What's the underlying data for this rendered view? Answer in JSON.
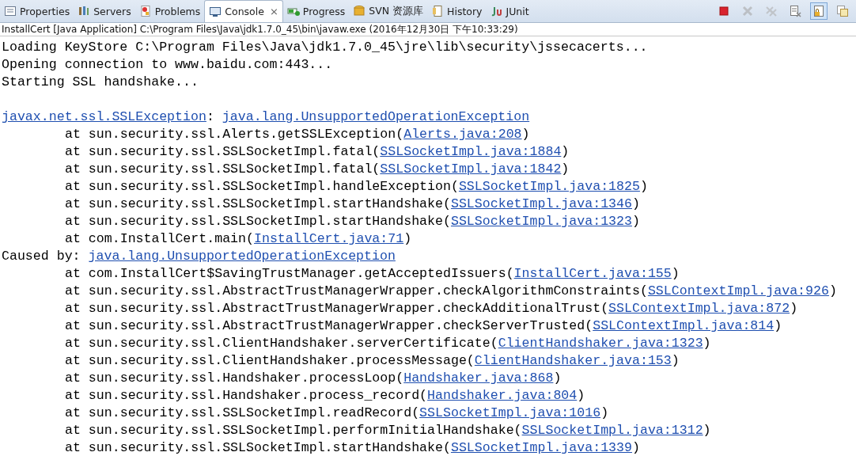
{
  "tabs": [
    {
      "label": "Properties",
      "selected": false
    },
    {
      "label": "Servers",
      "selected": false
    },
    {
      "label": "Problems",
      "selected": false
    },
    {
      "label": "Console",
      "selected": true,
      "close": "⨯"
    },
    {
      "label": "Progress",
      "selected": false
    },
    {
      "label": "SVN 资源库",
      "selected": false
    },
    {
      "label": "History",
      "selected": false
    },
    {
      "label": "JUnit",
      "selected": false
    }
  ],
  "toolbar": [
    {
      "kind": "stop",
      "disabled": false,
      "selected": false
    },
    {
      "kind": "remove",
      "disabled": true,
      "selected": false
    },
    {
      "kind": "remove-all",
      "disabled": true,
      "selected": false
    },
    {
      "kind": "clear",
      "disabled": false,
      "selected": false
    },
    {
      "kind": "scroll-lock",
      "disabled": false,
      "selected": true
    },
    {
      "kind": "word-wrap",
      "disabled": false,
      "selected": false
    }
  ],
  "status_line": "InstallCert [Java Application] C:\\Program Files\\Java\\jdk1.7.0_45\\bin\\javaw.exe (2016年12月30日 下午10:33:29)",
  "console_lines": [
    {
      "kind": "message",
      "parts": [
        {
          "kind": "text",
          "text": "Loading KeyStore C:\\Program Files\\Java\\jdk1.7.0_45\\jre\\lib\\security\\jssecacerts..."
        }
      ]
    },
    {
      "kind": "message",
      "parts": [
        {
          "kind": "text",
          "text": "Opening connection to www.baidu.com:443..."
        }
      ]
    },
    {
      "kind": "message",
      "parts": [
        {
          "kind": "text",
          "text": "Starting SSL handshake..."
        }
      ]
    },
    {
      "kind": "blank"
    },
    {
      "kind": "message",
      "parts": [
        {
          "kind": "link",
          "text": "javax.net.ssl.SSLException"
        },
        {
          "kind": "text",
          "text": ": "
        },
        {
          "kind": "link",
          "text": "java.lang.UnsupportedOperationException"
        }
      ]
    },
    {
      "kind": "frame",
      "parts": [
        {
          "kind": "text",
          "text": "at sun.security.ssl.Alerts.getSSLException("
        },
        {
          "kind": "link",
          "text": "Alerts.java:208"
        },
        {
          "kind": "text",
          "text": ")"
        }
      ]
    },
    {
      "kind": "frame",
      "parts": [
        {
          "kind": "text",
          "text": "at sun.security.ssl.SSLSocketImpl.fatal("
        },
        {
          "kind": "link",
          "text": "SSLSocketImpl.java:1884"
        },
        {
          "kind": "text",
          "text": ")"
        }
      ]
    },
    {
      "kind": "frame",
      "parts": [
        {
          "kind": "text",
          "text": "at sun.security.ssl.SSLSocketImpl.fatal("
        },
        {
          "kind": "link",
          "text": "SSLSocketImpl.java:1842"
        },
        {
          "kind": "text",
          "text": ")"
        }
      ]
    },
    {
      "kind": "frame",
      "parts": [
        {
          "kind": "text",
          "text": "at sun.security.ssl.SSLSocketImpl.handleException("
        },
        {
          "kind": "link",
          "text": "SSLSocketImpl.java:1825"
        },
        {
          "kind": "text",
          "text": ")"
        }
      ]
    },
    {
      "kind": "frame",
      "parts": [
        {
          "kind": "text",
          "text": "at sun.security.ssl.SSLSocketImpl.startHandshake("
        },
        {
          "kind": "link",
          "text": "SSLSocketImpl.java:1346"
        },
        {
          "kind": "text",
          "text": ")"
        }
      ]
    },
    {
      "kind": "frame",
      "parts": [
        {
          "kind": "text",
          "text": "at sun.security.ssl.SSLSocketImpl.startHandshake("
        },
        {
          "kind": "link",
          "text": "SSLSocketImpl.java:1323"
        },
        {
          "kind": "text",
          "text": ")"
        }
      ]
    },
    {
      "kind": "frame",
      "parts": [
        {
          "kind": "text",
          "text": "at com.InstallCert.main("
        },
        {
          "kind": "link",
          "text": "InstallCert.java:71"
        },
        {
          "kind": "text",
          "text": ")"
        }
      ]
    },
    {
      "kind": "message",
      "parts": [
        {
          "kind": "text",
          "text": "Caused by: "
        },
        {
          "kind": "link",
          "text": "java.lang.UnsupportedOperationException"
        }
      ]
    },
    {
      "kind": "frame",
      "parts": [
        {
          "kind": "text",
          "text": "at com.InstallCert$SavingTrustManager.getAcceptedIssuers("
        },
        {
          "kind": "link",
          "text": "InstallCert.java:155"
        },
        {
          "kind": "text",
          "text": ")"
        }
      ]
    },
    {
      "kind": "frame",
      "parts": [
        {
          "kind": "text",
          "text": "at sun.security.ssl.AbstractTrustManagerWrapper.checkAlgorithmConstraints("
        },
        {
          "kind": "link",
          "text": "SSLContextImpl.java:926"
        },
        {
          "kind": "text",
          "text": ")"
        }
      ]
    },
    {
      "kind": "frame",
      "parts": [
        {
          "kind": "text",
          "text": "at sun.security.ssl.AbstractTrustManagerWrapper.checkAdditionalTrust("
        },
        {
          "kind": "link",
          "text": "SSLContextImpl.java:872"
        },
        {
          "kind": "text",
          "text": ")"
        }
      ]
    },
    {
      "kind": "frame",
      "parts": [
        {
          "kind": "text",
          "text": "at sun.security.ssl.AbstractTrustManagerWrapper.checkServerTrusted("
        },
        {
          "kind": "link",
          "text": "SSLContextImpl.java:814"
        },
        {
          "kind": "text",
          "text": ")"
        }
      ]
    },
    {
      "kind": "frame",
      "parts": [
        {
          "kind": "text",
          "text": "at sun.security.ssl.ClientHandshaker.serverCertificate("
        },
        {
          "kind": "link",
          "text": "ClientHandshaker.java:1323"
        },
        {
          "kind": "text",
          "text": ")"
        }
      ]
    },
    {
      "kind": "frame",
      "parts": [
        {
          "kind": "text",
          "text": "at sun.security.ssl.ClientHandshaker.processMessage("
        },
        {
          "kind": "link",
          "text": "ClientHandshaker.java:153"
        },
        {
          "kind": "text",
          "text": ")"
        }
      ]
    },
    {
      "kind": "frame",
      "parts": [
        {
          "kind": "text",
          "text": "at sun.security.ssl.Handshaker.processLoop("
        },
        {
          "kind": "link",
          "text": "Handshaker.java:868"
        },
        {
          "kind": "text",
          "text": ")"
        }
      ]
    },
    {
      "kind": "frame",
      "parts": [
        {
          "kind": "text",
          "text": "at sun.security.ssl.Handshaker.process_record("
        },
        {
          "kind": "link",
          "text": "Handshaker.java:804"
        },
        {
          "kind": "text",
          "text": ")"
        }
      ]
    },
    {
      "kind": "frame",
      "parts": [
        {
          "kind": "text",
          "text": "at sun.security.ssl.SSLSocketImpl.readRecord("
        },
        {
          "kind": "link",
          "text": "SSLSocketImpl.java:1016"
        },
        {
          "kind": "text",
          "text": ")"
        }
      ]
    },
    {
      "kind": "frame",
      "parts": [
        {
          "kind": "text",
          "text": "at sun.security.ssl.SSLSocketImpl.performInitialHandshake("
        },
        {
          "kind": "link",
          "text": "SSLSocketImpl.java:1312"
        },
        {
          "kind": "text",
          "text": ")"
        }
      ]
    },
    {
      "kind": "frame",
      "parts": [
        {
          "kind": "text",
          "text": "at sun.security.ssl.SSLSocketImpl.startHandshake("
        },
        {
          "kind": "link",
          "text": "SSLSocketImpl.java:1339"
        },
        {
          "kind": "text",
          "text": ")"
        }
      ]
    }
  ]
}
